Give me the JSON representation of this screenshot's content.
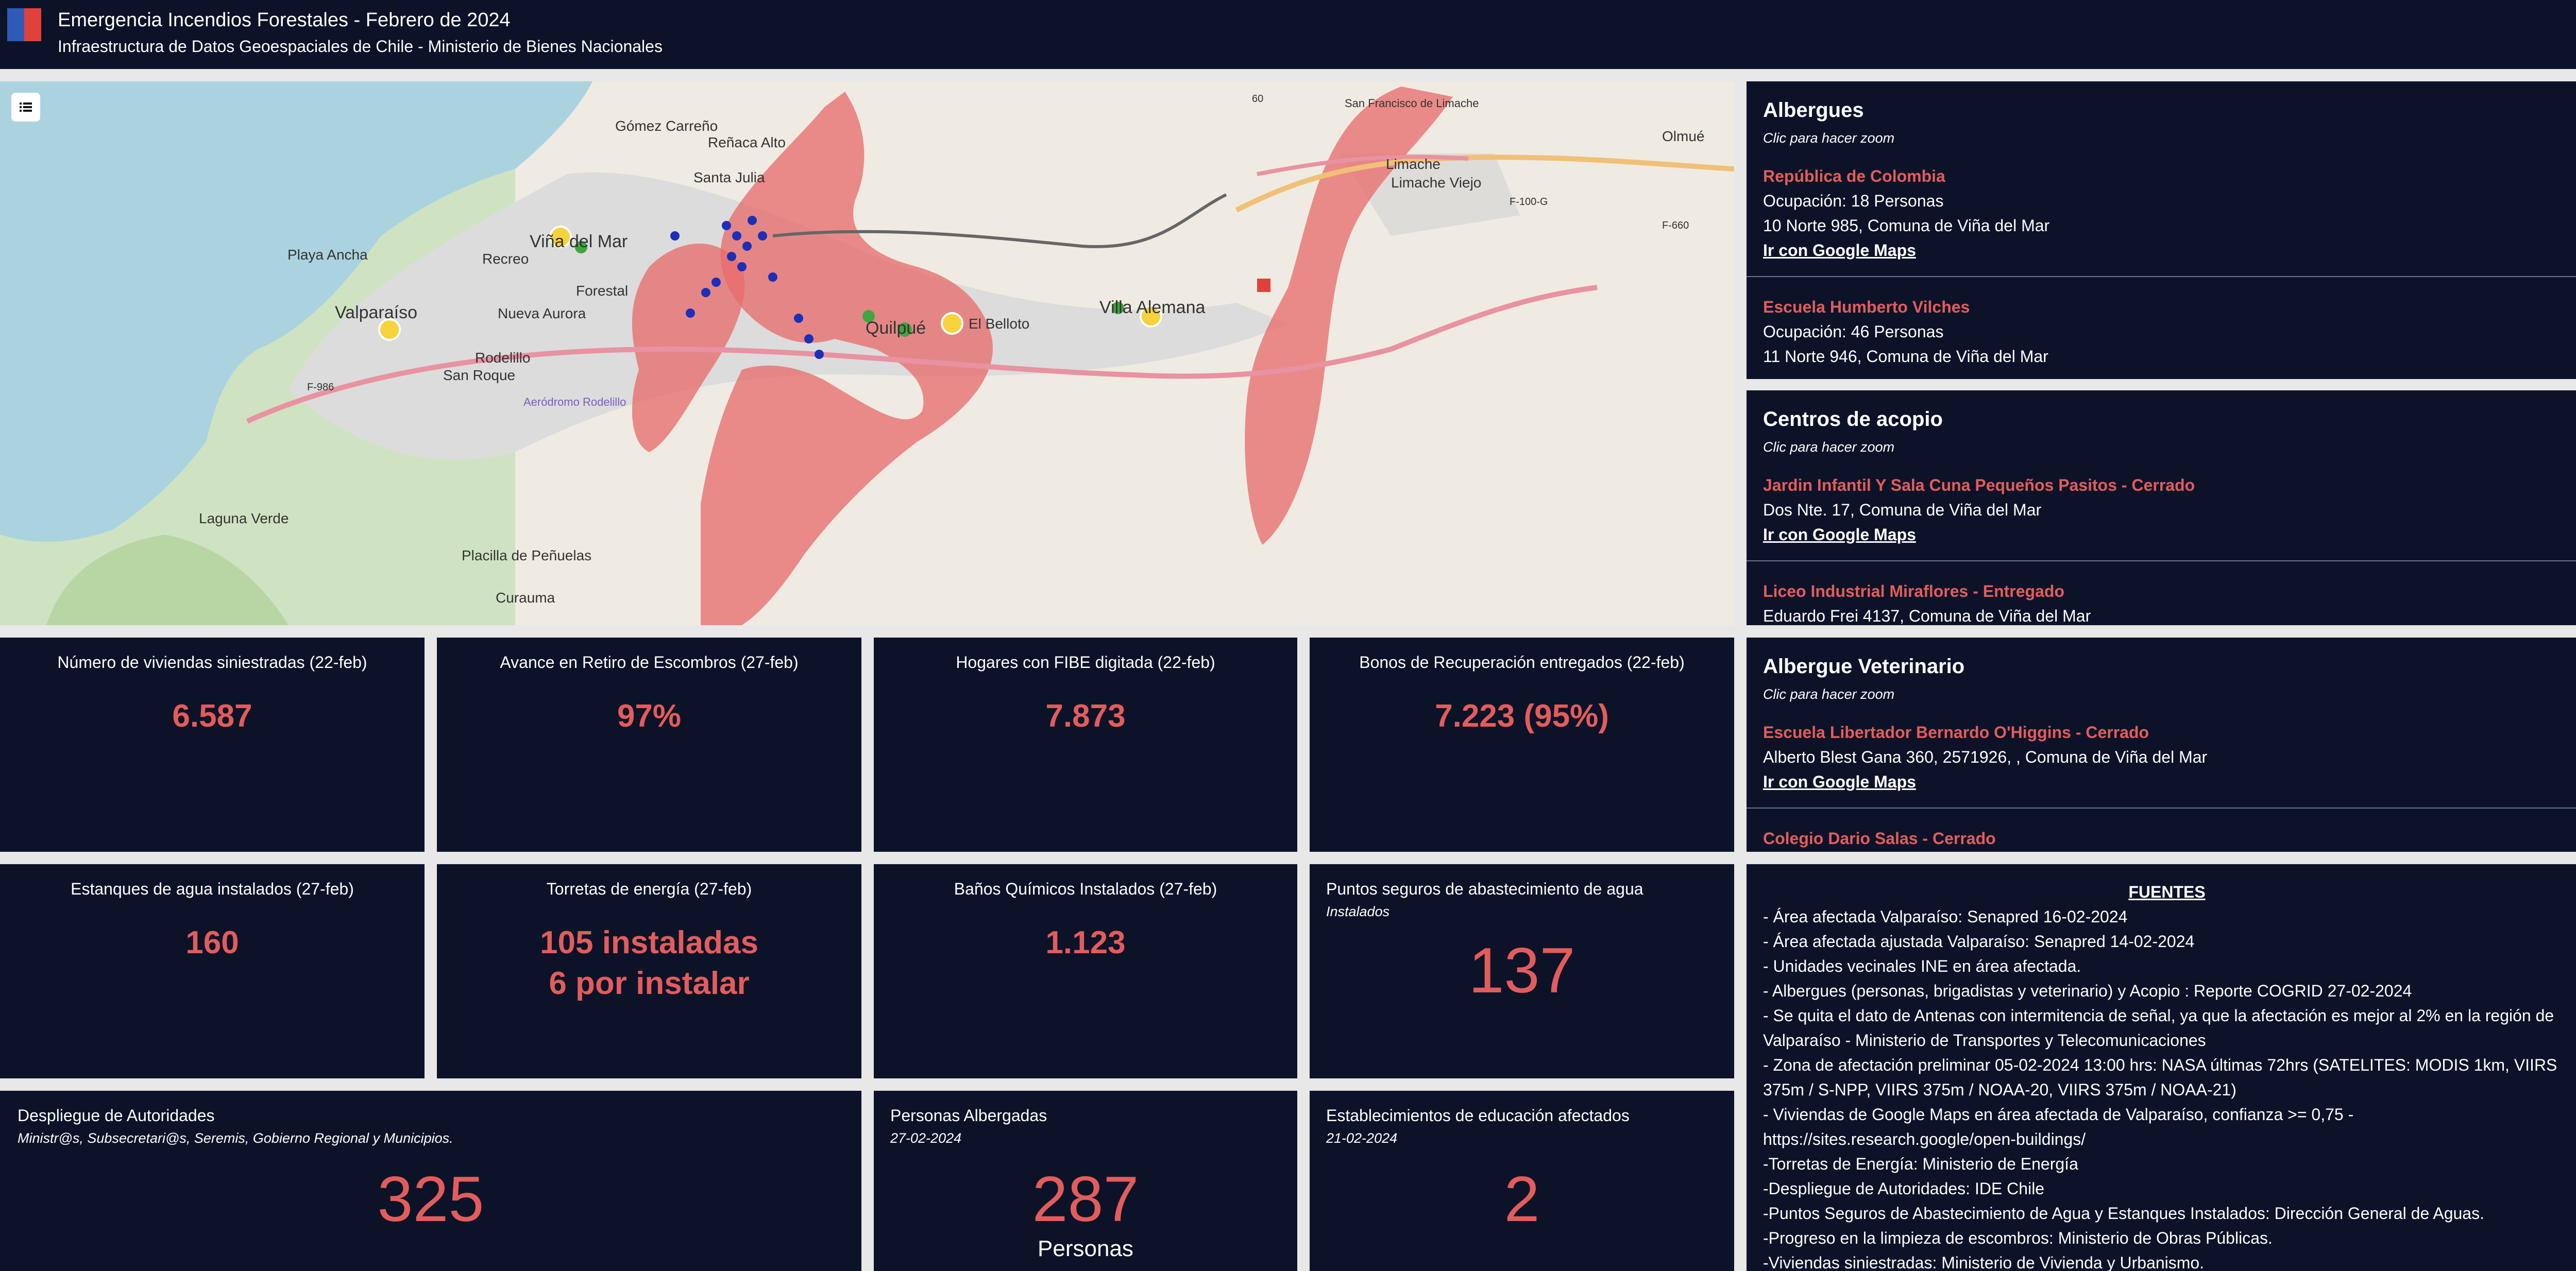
{
  "header": {
    "title": "Emergencia Incendios Forestales - Febrero de 2024",
    "subtitle": "Infraestructura de Datos Geoespaciales de Chile - Ministerio de Bienes Nacionales"
  },
  "map": {
    "labels": [
      "Gómez Carreño",
      "Reñaca Alto",
      "Santa Julia",
      "Viña del Mar",
      "Playa Ancha",
      "Recreo",
      "Forestal",
      "Valparaíso",
      "Nueva Aurora",
      "Rodelillo",
      "San Roque",
      "Aeródromo Rodelillo",
      "Laguna Verde",
      "Placilla de Peñuelas",
      "Curauma",
      "Quilpué",
      "El Belloto",
      "Villa Alemana",
      "Limache",
      "Limache Viejo",
      "Olmué",
      "San Francisco de Limache",
      "F-100-G",
      "F-660",
      "F-986",
      "60"
    ],
    "colors": {
      "burn": "#e86a6a",
      "water": "#aad3df",
      "marker": "#f6d23c"
    }
  },
  "albergues": {
    "title": "Albergues",
    "hint": "Clic para hacer zoom",
    "items": [
      {
        "name": "República de Colombia",
        "occupancy": "Ocupación: 18 Personas",
        "address": "10 Norte 985, Comuna de Viña del Mar",
        "link": "Ir con Google Maps"
      },
      {
        "name": "Escuela Humberto Vilches",
        "occupancy": "Ocupación: 46 Personas",
        "address": "11 Norte 946, Comuna de Viña del Mar"
      }
    ]
  },
  "acopio": {
    "title": "Centros de acopio",
    "hint": "Clic para hacer zoom",
    "items": [
      {
        "name": "Jardin Infantil Y Sala Cuna Pequeños Pasitos - Cerrado",
        "address": "Dos Nte. 17, Comuna de Viña del Mar",
        "link": "Ir con Google Maps"
      },
      {
        "name": "Liceo Industrial Miraflores - Entregado",
        "address": "Eduardo Frei 4137, Comuna de Viña del Mar"
      }
    ]
  },
  "veterinario": {
    "title": "Albergue Veterinario",
    "hint": "Clic para hacer zoom",
    "items": [
      {
        "name": "Escuela Libertador Bernardo O'Higgins - Cerrado",
        "address": "Alberto Blest Gana 360, 2571926, , Comuna de Viña del Mar",
        "link": "Ir con Google Maps"
      },
      {
        "name": "Colegio Dario Salas - Cerrado"
      }
    ]
  },
  "stats_row1": [
    {
      "label": "Número de viviendas siniestradas (22-feb)",
      "value": "6.587"
    },
    {
      "label": "Avance en Retiro de Escombros (27-feb)",
      "value": "97%"
    },
    {
      "label": "Hogares con FIBE digitada (22-feb)",
      "value": "7.873"
    },
    {
      "label": "Bonos de Recuperación entregados (22-feb)",
      "value": "7.223 (95%)"
    }
  ],
  "stats_row2": [
    {
      "label": "Estanques de agua instalados (27-feb)",
      "value": "160"
    },
    {
      "label": "Torretas de energía (27-feb)",
      "value": "105 instaladas",
      "value2": "6 por instalar"
    },
    {
      "label": "Baños Químicos Instalados (27-feb)",
      "value": "1.123"
    }
  ],
  "puntos": {
    "label": "Puntos seguros de abastecimiento de agua",
    "sub": "Instalados",
    "value": "137"
  },
  "despliegue": {
    "label": "Despliegue de Autoridades",
    "sub": "Ministr@s, Subsecretari@s, Seremis, Gobierno Regional y Municipios.",
    "value": "325"
  },
  "albergadas": {
    "label": "Personas Albergadas",
    "sub": "27-02-2024",
    "value": "287",
    "unit": "Personas"
  },
  "educacion": {
    "label": "Establecimientos de educación afectados",
    "sub": "21-02-2024",
    "value": "2"
  },
  "fuentes": {
    "title": "FUENTES",
    "lines": [
      "- Área afectada Valparaíso: Senapred 16-02-2024",
      "- Área afectada ajustada Valparaíso: Senapred 14-02-2024",
      "- Unidades vecinales INE en área afectada.",
      "- Albergues (personas, brigadistas y veterinario) y Acopio : Reporte COGRID 27-02-2024",
      "- Se quita el dato de Antenas con intermitencia de señal, ya que la afectación es mejor al 2% en la región de Valparaíso - Ministerio de Transportes y Telecomunicaciones",
      "- Zona de afectación preliminar 05-02-2024 13:00 hrs: NASA últimas 72hrs (SATELITES: MODIS 1km, VIIRS 375m / S-NPP, VIIRS 375m / NOAA-20, VIIRS 375m / NOAA-21)",
      "- Viviendas de Google Maps en área afectada de Valparaíso,  confianza >= 0,75 - https://sites.research.google/open-buildings/",
      "-Torretas de Energía: Ministerio de Energía",
      "-Despliegue de Autoridades: IDE Chile",
      "-Puntos Seguros de Abastecimiento de Agua y Estanques Instalados: Dirección General de Aguas.",
      "-Progreso en la limpieza de escombros: Ministerio de Obras Públicas.",
      "-Viviendas siniestradas: Ministerio de Vivienda y Urbanismo."
    ]
  }
}
